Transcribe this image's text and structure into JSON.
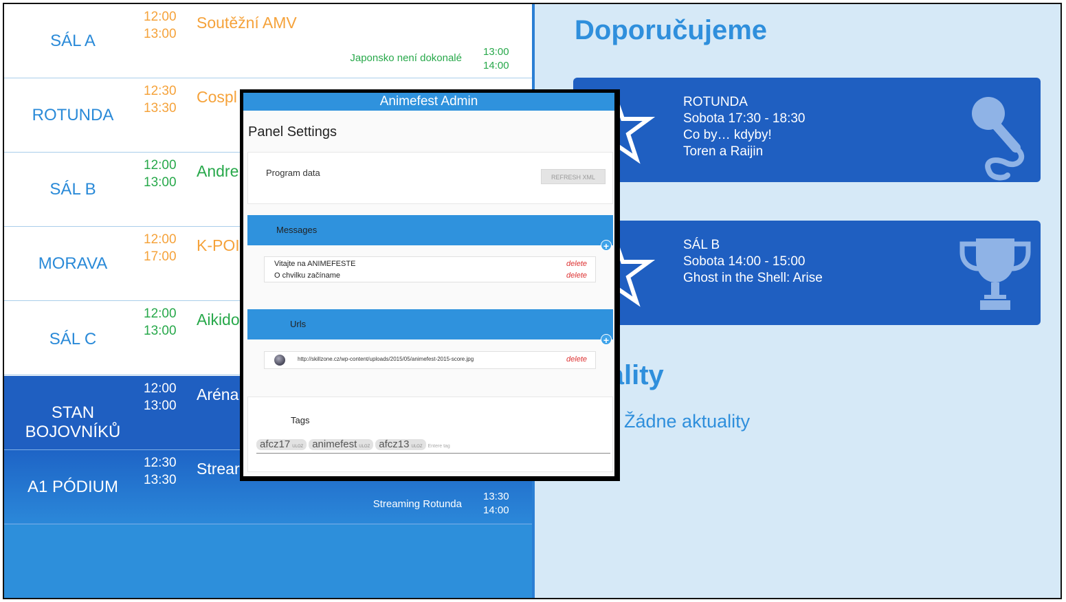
{
  "schedule": {
    "rows": [
      {
        "room": "SÁL A",
        "time_start": "12:00",
        "time_end": "13:00",
        "title": "Soutěžní AMV",
        "next_title": "Japonsko není dokonalé",
        "next_start": "13:00",
        "next_end": "14:00"
      },
      {
        "room": "ROTUNDA",
        "time_start": "12:30",
        "time_end": "13:30",
        "title": "Cospl"
      },
      {
        "room": "SÁL B",
        "time_start": "12:00",
        "time_end": "13:00",
        "title": "Andre"
      },
      {
        "room": "MORAVA",
        "time_start": "12:00",
        "time_end": "17:00",
        "title": "K-POI"
      },
      {
        "room": "SÁL C",
        "time_start": "12:00",
        "time_end": "13:00",
        "title": "Aikido"
      },
      {
        "room_line1": "STAN",
        "room_line2": "BOJOVNÍKŮ",
        "time_start": "12:00",
        "time_end": "13:00",
        "title": "Aréna"
      },
      {
        "room": "A1 PÓDIUM",
        "time_start": "12:30",
        "time_end": "13:30",
        "title": "Strear",
        "next_title": "Streaming Rotunda",
        "next_start": "13:30",
        "next_end": "14:00"
      }
    ]
  },
  "recommend": {
    "title": "Doporučujeme",
    "cards": [
      {
        "room": "ROTUNDA",
        "time": "Sobota 17:30 - 18:30",
        "title": "Co by… kdyby!",
        "author": "Toren a Raijin",
        "icon": "microphone-icon"
      },
      {
        "room": "SÁL B",
        "time": "Sobota 14:00 - 15:00",
        "title": "Ghost in the Shell: Arise",
        "icon": "trophy-icon"
      }
    ]
  },
  "news": {
    "title": "tuality",
    "empty": "Žádne aktuality"
  },
  "admin": {
    "header": "Animefest Admin",
    "panel_title": "Panel Settings",
    "program_label": "Program data",
    "refresh_label": "REFRESH XML",
    "messages_label": "Messages",
    "messages": [
      {
        "text": "Vitajte na ANIMEFESTE",
        "action": "delete"
      },
      {
        "text": "O chvilku začíname",
        "action": "delete"
      }
    ],
    "urls_label": "Urls",
    "urls": [
      {
        "text": "http://skillzone.cz/wp-content/uploads/2015/05/animefest-2015-score.jpg",
        "action": "delete"
      }
    ],
    "tags_label": "Tags",
    "tags": [
      {
        "text": "afcz17",
        "remove": "ULOZ"
      },
      {
        "text": "animefest",
        "remove": "ULOZ"
      },
      {
        "text": "afcz13",
        "remove": "ULOZ"
      }
    ],
    "tag_placeholder": "Entere tag"
  },
  "colors": {
    "accent": "#2f8fdc",
    "dark_blue": "#1f5fc1",
    "orange": "#f5a23a",
    "green": "#27a84a",
    "light_panel": "#d6e9f7"
  }
}
